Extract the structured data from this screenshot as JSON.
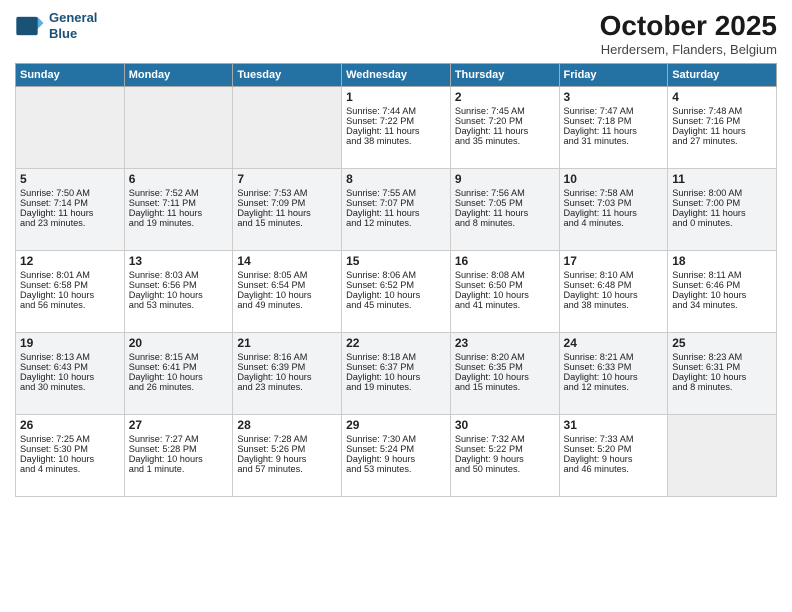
{
  "header": {
    "logo_line1": "General",
    "logo_line2": "Blue",
    "month": "October 2025",
    "location": "Herdersem, Flanders, Belgium"
  },
  "days_of_week": [
    "Sunday",
    "Monday",
    "Tuesday",
    "Wednesday",
    "Thursday",
    "Friday",
    "Saturday"
  ],
  "weeks": [
    [
      {
        "day": "",
        "info": ""
      },
      {
        "day": "",
        "info": ""
      },
      {
        "day": "",
        "info": ""
      },
      {
        "day": "1",
        "info": "Sunrise: 7:44 AM\nSunset: 7:22 PM\nDaylight: 11 hours\nand 38 minutes."
      },
      {
        "day": "2",
        "info": "Sunrise: 7:45 AM\nSunset: 7:20 PM\nDaylight: 11 hours\nand 35 minutes."
      },
      {
        "day": "3",
        "info": "Sunrise: 7:47 AM\nSunset: 7:18 PM\nDaylight: 11 hours\nand 31 minutes."
      },
      {
        "day": "4",
        "info": "Sunrise: 7:48 AM\nSunset: 7:16 PM\nDaylight: 11 hours\nand 27 minutes."
      }
    ],
    [
      {
        "day": "5",
        "info": "Sunrise: 7:50 AM\nSunset: 7:14 PM\nDaylight: 11 hours\nand 23 minutes."
      },
      {
        "day": "6",
        "info": "Sunrise: 7:52 AM\nSunset: 7:11 PM\nDaylight: 11 hours\nand 19 minutes."
      },
      {
        "day": "7",
        "info": "Sunrise: 7:53 AM\nSunset: 7:09 PM\nDaylight: 11 hours\nand 15 minutes."
      },
      {
        "day": "8",
        "info": "Sunrise: 7:55 AM\nSunset: 7:07 PM\nDaylight: 11 hours\nand 12 minutes."
      },
      {
        "day": "9",
        "info": "Sunrise: 7:56 AM\nSunset: 7:05 PM\nDaylight: 11 hours\nand 8 minutes."
      },
      {
        "day": "10",
        "info": "Sunrise: 7:58 AM\nSunset: 7:03 PM\nDaylight: 11 hours\nand 4 minutes."
      },
      {
        "day": "11",
        "info": "Sunrise: 8:00 AM\nSunset: 7:00 PM\nDaylight: 11 hours\nand 0 minutes."
      }
    ],
    [
      {
        "day": "12",
        "info": "Sunrise: 8:01 AM\nSunset: 6:58 PM\nDaylight: 10 hours\nand 56 minutes."
      },
      {
        "day": "13",
        "info": "Sunrise: 8:03 AM\nSunset: 6:56 PM\nDaylight: 10 hours\nand 53 minutes."
      },
      {
        "day": "14",
        "info": "Sunrise: 8:05 AM\nSunset: 6:54 PM\nDaylight: 10 hours\nand 49 minutes."
      },
      {
        "day": "15",
        "info": "Sunrise: 8:06 AM\nSunset: 6:52 PM\nDaylight: 10 hours\nand 45 minutes."
      },
      {
        "day": "16",
        "info": "Sunrise: 8:08 AM\nSunset: 6:50 PM\nDaylight: 10 hours\nand 41 minutes."
      },
      {
        "day": "17",
        "info": "Sunrise: 8:10 AM\nSunset: 6:48 PM\nDaylight: 10 hours\nand 38 minutes."
      },
      {
        "day": "18",
        "info": "Sunrise: 8:11 AM\nSunset: 6:46 PM\nDaylight: 10 hours\nand 34 minutes."
      }
    ],
    [
      {
        "day": "19",
        "info": "Sunrise: 8:13 AM\nSunset: 6:43 PM\nDaylight: 10 hours\nand 30 minutes."
      },
      {
        "day": "20",
        "info": "Sunrise: 8:15 AM\nSunset: 6:41 PM\nDaylight: 10 hours\nand 26 minutes."
      },
      {
        "day": "21",
        "info": "Sunrise: 8:16 AM\nSunset: 6:39 PM\nDaylight: 10 hours\nand 23 minutes."
      },
      {
        "day": "22",
        "info": "Sunrise: 8:18 AM\nSunset: 6:37 PM\nDaylight: 10 hours\nand 19 minutes."
      },
      {
        "day": "23",
        "info": "Sunrise: 8:20 AM\nSunset: 6:35 PM\nDaylight: 10 hours\nand 15 minutes."
      },
      {
        "day": "24",
        "info": "Sunrise: 8:21 AM\nSunset: 6:33 PM\nDaylight: 10 hours\nand 12 minutes."
      },
      {
        "day": "25",
        "info": "Sunrise: 8:23 AM\nSunset: 6:31 PM\nDaylight: 10 hours\nand 8 minutes."
      }
    ],
    [
      {
        "day": "26",
        "info": "Sunrise: 7:25 AM\nSunset: 5:30 PM\nDaylight: 10 hours\nand 4 minutes."
      },
      {
        "day": "27",
        "info": "Sunrise: 7:27 AM\nSunset: 5:28 PM\nDaylight: 10 hours\nand 1 minute."
      },
      {
        "day": "28",
        "info": "Sunrise: 7:28 AM\nSunset: 5:26 PM\nDaylight: 9 hours\nand 57 minutes."
      },
      {
        "day": "29",
        "info": "Sunrise: 7:30 AM\nSunset: 5:24 PM\nDaylight: 9 hours\nand 53 minutes."
      },
      {
        "day": "30",
        "info": "Sunrise: 7:32 AM\nSunset: 5:22 PM\nDaylight: 9 hours\nand 50 minutes."
      },
      {
        "day": "31",
        "info": "Sunrise: 7:33 AM\nSunset: 5:20 PM\nDaylight: 9 hours\nand 46 minutes."
      },
      {
        "day": "",
        "info": ""
      }
    ]
  ]
}
